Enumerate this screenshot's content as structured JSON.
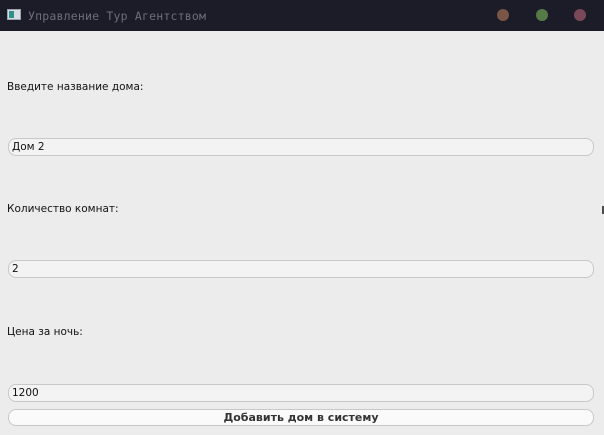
{
  "window": {
    "title": "Управление Тур Агентством",
    "icon": "app-window-icon",
    "controls": {
      "minimize_color": "#7a5648",
      "maximize_color": "#557a48",
      "close_color": "#7a4858"
    }
  },
  "form": {
    "name_label": "Введите название дома:",
    "name_value": "Дом 2",
    "rooms_label": "Количество комнат:",
    "rooms_value": "2",
    "price_label": "Цена за ночь:",
    "price_value": "1200",
    "submit_label": "Добавить дом в систему"
  },
  "colors": {
    "titlebar_bg": "#1c1c28",
    "window_bg": "#ececec"
  }
}
